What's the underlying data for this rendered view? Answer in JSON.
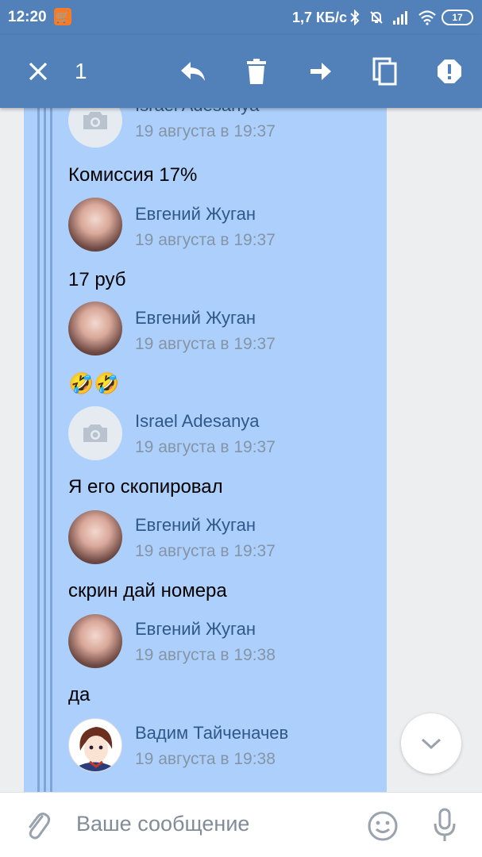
{
  "status_bar": {
    "time": "12:20",
    "app_badge": "🛒",
    "net_speed": "1,7 КБ/с",
    "battery": "17"
  },
  "action_bar": {
    "selected_count": "1",
    "close_icon": "close-icon",
    "reply_icon": "reply-icon",
    "delete_icon": "trash-icon",
    "forward_icon": "forward-icon",
    "copy_icon": "copy-icon",
    "report_icon": "alert-icon"
  },
  "messages": [
    {
      "author": "Israel Adesanya",
      "time": "19 августа в 19:37",
      "text": "Комиссия 17%",
      "avatar": "camera-placeholder"
    },
    {
      "author": "Евгений Жуган",
      "time": "19 августа в 19:37",
      "text": "17 руб",
      "avatar": "photo"
    },
    {
      "author": "Евгений Жуган",
      "time": "19 августа в 19:37",
      "text": "🤣🤣",
      "avatar": "photo"
    },
    {
      "author": "Israel Adesanya",
      "time": "19 августа в 19:37",
      "text": "Я его скопировал",
      "avatar": "camera-placeholder"
    },
    {
      "author": "Евгений Жуган",
      "time": "19 августа в 19:37",
      "text": "скрин дай номера",
      "avatar": "photo"
    },
    {
      "author": "Евгений Жуган",
      "time": "19 августа в 19:38",
      "text": "да",
      "avatar": "photo"
    },
    {
      "author": "Вадим Тайченачев",
      "time": "19 августа в 19:38",
      "text": "",
      "avatar": "anime"
    }
  ],
  "composer": {
    "placeholder": "Ваше сообщение"
  },
  "colors": {
    "header": "#5181b8",
    "selection": "#acd0fb",
    "author": "#2f5888",
    "time": "#8594a6"
  }
}
